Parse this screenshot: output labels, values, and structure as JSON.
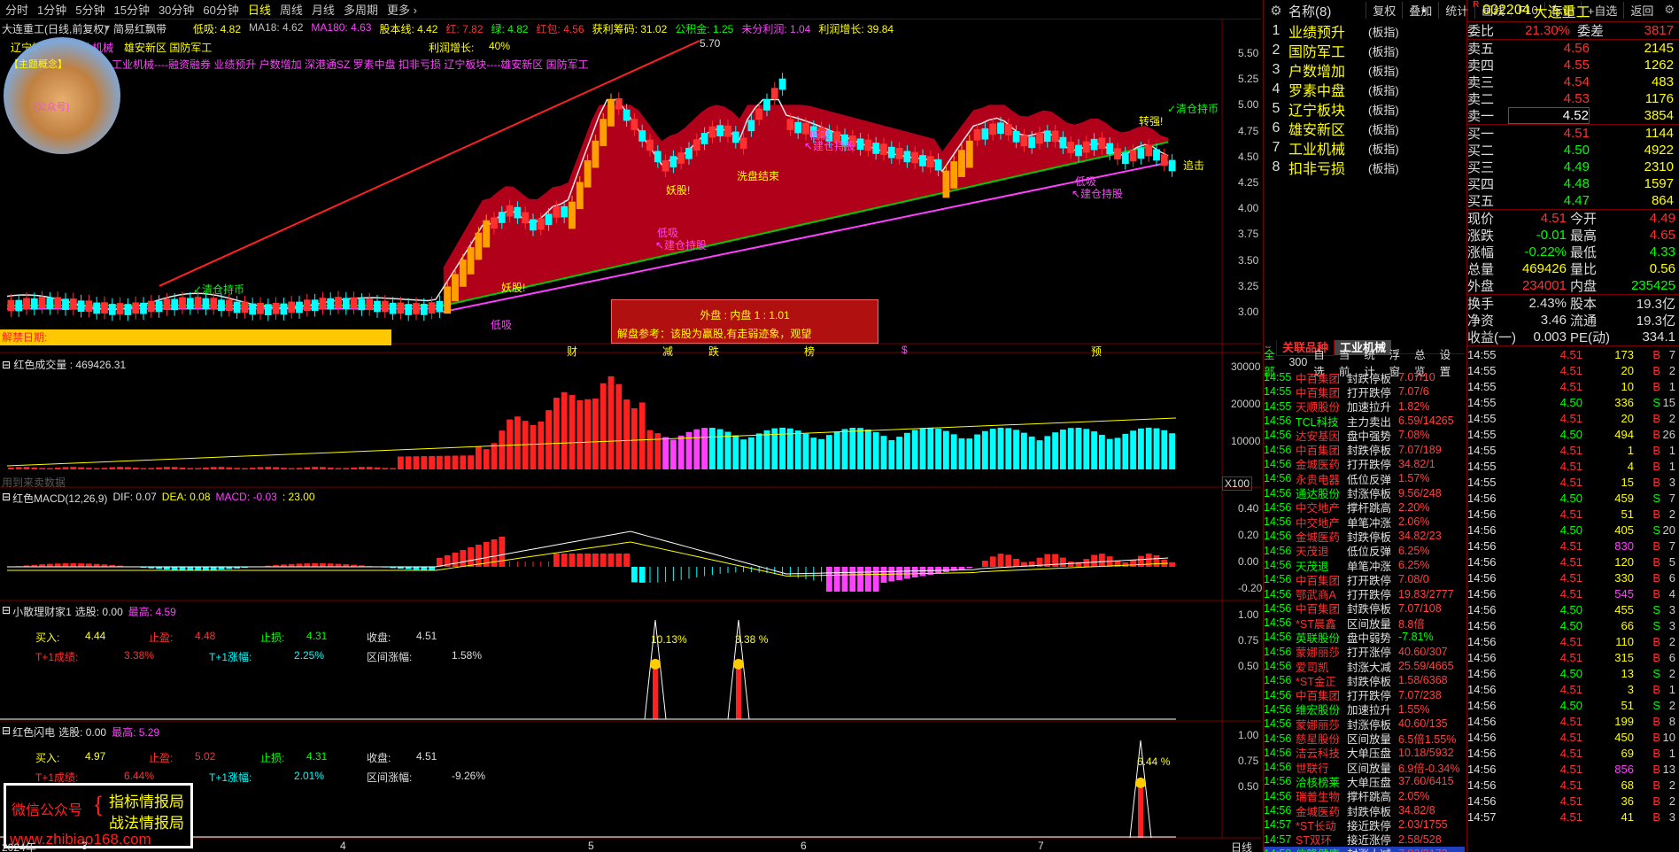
{
  "periods": [
    "分时",
    "1分钟",
    "5分钟",
    "15分钟",
    "30分钟",
    "60分钟",
    "日线",
    "周线",
    "月线",
    "多周期",
    "更多 ›"
  ],
  "toolbar": [
    "复权",
    "叠加",
    "统计",
    "画线",
    "F10",
    "标记",
    "+自选",
    "返回"
  ],
  "main": {
    "title": "大连重工(日线,前复权)",
    "indicator": "简易红飘带",
    "ma": [
      {
        "t": "低吸: 4.82",
        "c": "#ffff00"
      },
      {
        "t": "MA18: 4.62",
        "c": "#c0c0c0"
      },
      {
        "t": "MA180: 4.63",
        "c": "#ff40ff"
      },
      {
        "t": "股本线: 4.42",
        "c": "#ffff00"
      },
      {
        "t": "红: 7.82",
        "c": "#ff3030"
      },
      {
        "t": "绿: 4.82",
        "c": "#00ff00"
      },
      {
        "t": "红包: 4.56",
        "c": "#ff3030"
      },
      {
        "t": "获利筹码: 31.02",
        "c": "#ffff00"
      },
      {
        "t": "公积金: 1.25",
        "c": "#00ff00"
      },
      {
        "t": "未分利润: 1.04",
        "c": "#ff40ff"
      },
      {
        "t": "利润增长: 39.84",
        "c": "#ffff00"
      }
    ],
    "sectors_line1": "辽宁板块",
    "sectors_line1b": "工业机械",
    "sectors_line1c": "雄安新区 国防军工",
    "profit_growth": "利润增长:",
    "profit_growth_val": "40%",
    "concepts": "工业机械----融资融券 业绩预升 户数增加 深港通SZ 罗素中盘 扣非亏损 辽宁板块----雄安新区 国防军工",
    "logo_top": "【主题概念】",
    "logo_mid": "(公众号)",
    "unlock": "解禁日期:",
    "price_high_label": "5.70",
    "yaxis": [
      "5.50",
      "5.25",
      "5.00",
      "4.75",
      "4.50",
      "4.25",
      "4.00",
      "3.75",
      "3.50",
      "3.25",
      "3.00"
    ],
    "annotations": {
      "qingcang1": "✓清仓持币",
      "qingcang2": "✓清仓持币",
      "yaogu1": "妖股!",
      "yaogu2": "妖股!",
      "dixi1": "低吸",
      "dixi2": "低吸",
      "dixi3": "低吸",
      "jiancang1": "↖建仓持股",
      "jiancang2": "↖建仓持股",
      "jiancang3": "↖建仓持股",
      "huadixi": "低吸",
      "huapan": "洗盘结束",
      "zhuanqiang": "转强!",
      "zhuiji": "追击"
    },
    "popup_line1": "外盘 : 内盘  1 : 1.01",
    "popup_line2": "解盘参考：该股为赢股,有走弱迹象，观望",
    "markers": [
      "财",
      "减",
      "跌",
      "榜",
      "$",
      "预"
    ]
  },
  "vol": {
    "title": "红色成交量 : 469426.31",
    "yaxis": [
      "30000",
      "20000",
      "10000"
    ],
    "unit": "X100",
    "watermark": "用到来卖数据"
  },
  "macd": {
    "title": "红色MACD(12,26,9)",
    "dif": "DIF: 0.07",
    "dea": "DEA: 0.08",
    "macd": "MACD: -0.03",
    "extra": ": 23.00",
    "yaxis": [
      "0.40",
      "0.20",
      "0.00",
      "-0.20"
    ]
  },
  "ind1": {
    "title": "小散理财家1",
    "select": "选股: 0.00",
    "high": "最高: 4.59",
    "buy_l": "买入:",
    "buy_v": "4.44",
    "tp_l": "止盈:",
    "tp_v": "4.48",
    "sl_l": "止损:",
    "sl_v": "4.31",
    "close_l": "收盘:",
    "close_v": "4.51",
    "t1_l": "T+1成绩:",
    "t1_v": "3.38%",
    "t1z_l": "T+1涨幅:",
    "t1z_v": "2.25%",
    "rng_l": "区间涨幅:",
    "rng_v": "1.58%",
    "pk1": "10.13%",
    "pk2": "3.38 %",
    "yaxis": [
      "1.00",
      "0.75",
      "0.50"
    ]
  },
  "ind2": {
    "title": "红色闪电",
    "select": "选股: 0.00",
    "high": "最高: 5.29",
    "buy_l": "买入:",
    "buy_v": "4.97",
    "tp_l": "止盈:",
    "tp_v": "5.02",
    "sl_l": "止损:",
    "sl_v": "4.31",
    "close_l": "收盘:",
    "close_v": "4.51",
    "t1_l": "T+1成绩:",
    "t1_v": "6.44%",
    "t1z_l": "T+1涨幅:",
    "t1z_v": "2.01%",
    "rng_l": "区间涨幅:",
    "rng_v": "-9.26%",
    "pk1": "6.44 %",
    "yaxis": [
      "1.00",
      "0.75",
      "0.50"
    ]
  },
  "xaxis": [
    "2024年",
    "3",
    "4",
    "5",
    "6",
    "7"
  ],
  "xaxis_right": "日线",
  "ad": {
    "l1": "微信公众号",
    "b1": "指标情报局",
    "b2": "战法情报局",
    "url": "www.zhibiao168.com"
  },
  "sectors": {
    "header": "名称(8)",
    "items": [
      {
        "n": "1",
        "name": "业绩预升",
        "tag": "(板指)"
      },
      {
        "n": "2",
        "name": "国防军工",
        "tag": "(板指)"
      },
      {
        "n": "3",
        "name": "户数增加",
        "tag": "(板指)"
      },
      {
        "n": "4",
        "name": "罗素中盘",
        "tag": "(板指)"
      },
      {
        "n": "5",
        "name": "辽宁板块",
        "tag": "(板指)"
      },
      {
        "n": "6",
        "name": "雄安新区",
        "tag": "(板指)"
      },
      {
        "n": "7",
        "name": "工业机械",
        "tag": "(板指)"
      },
      {
        "n": "8",
        "name": "扣非亏损",
        "tag": "(板指)"
      }
    ]
  },
  "feed": {
    "tab1": "关联品种",
    "tab2": "工业机械",
    "subtabs": [
      "全部",
      "300",
      "自选",
      "当前",
      "统计",
      "浮窗",
      "总览",
      "设置"
    ],
    "rows": [
      {
        "t": "14:55",
        "s": "中百集团",
        "e": "封跌停板",
        "v": "7.07/10"
      },
      {
        "t": "14:55",
        "s": "中百集团",
        "e": "打开跌停",
        "v": "7.07/6"
      },
      {
        "t": "14:55",
        "s": "天顺股份",
        "e": "加速拉升",
        "v": "1.82%"
      },
      {
        "t": "14:56",
        "s": "TCL科技",
        "e": "主力卖出",
        "v": "6.59/14265"
      },
      {
        "t": "14:56",
        "s": "达安基因",
        "e": "盘中强势",
        "v": "7.08%"
      },
      {
        "t": "14:56",
        "s": "中百集团",
        "e": "封跌停板",
        "v": "7.07/189"
      },
      {
        "t": "14:56",
        "s": "金城医药",
        "e": "打开跌停",
        "v": "34.82/1"
      },
      {
        "t": "14:56",
        "s": "永贵电器",
        "e": "低位反弹",
        "v": "1.57%"
      },
      {
        "t": "14:56",
        "s": "通达股份",
        "e": "封涨停板",
        "v": "9.56/248"
      },
      {
        "t": "14:56",
        "s": "中交地产",
        "e": "撑杆跳高",
        "v": "2.20%"
      },
      {
        "t": "14:56",
        "s": "中交地产",
        "e": "单笔冲涨",
        "v": "2.06%"
      },
      {
        "t": "14:56",
        "s": "金城医药",
        "e": "封跌停板",
        "v": "34.82/23"
      },
      {
        "t": "14:56",
        "s": "天茂退",
        "e": "低位反弹",
        "v": "6.25%"
      },
      {
        "t": "14:56",
        "s": "天茂退",
        "e": "单笔冲涨",
        "v": "6.25%"
      },
      {
        "t": "14:56",
        "s": "中百集团",
        "e": "打开跌停",
        "v": "7.08/0"
      },
      {
        "t": "14:56",
        "s": "鄂武商A",
        "e": "打开跌停",
        "v": "19.83/2777"
      },
      {
        "t": "14:56",
        "s": "中百集团",
        "e": "封跌停板",
        "v": "7.07/108"
      },
      {
        "t": "14:56",
        "s": "*ST晨鑫",
        "e": "区间放量",
        "v": "8.8倍"
      },
      {
        "t": "14:56",
        "s": "英联股份",
        "e": "盘中弱势",
        "v": "-7.81%"
      },
      {
        "t": "14:56",
        "s": "蒙娜丽莎",
        "e": "打开涨停",
        "v": "40.60/307"
      },
      {
        "t": "14:56",
        "s": "爱司凯",
        "e": "封涨大减",
        "v": "25.59/4665"
      },
      {
        "t": "14:56",
        "s": "*ST金正",
        "e": "封跌停板",
        "v": "1.58/6368"
      },
      {
        "t": "14:56",
        "s": "中百集团",
        "e": "打开跌停",
        "v": "7.07/238"
      },
      {
        "t": "14:56",
        "s": "维宏股份",
        "e": "加速拉升",
        "v": "1.55%"
      },
      {
        "t": "14:56",
        "s": "蒙娜丽莎",
        "e": "封涨停板",
        "v": "40.60/135"
      },
      {
        "t": "14:56",
        "s": "慈星股份",
        "e": "区间放量",
        "v": "6.5倍1.55%"
      },
      {
        "t": "14:56",
        "s": "洁云科技",
        "e": "大单压盘",
        "v": "10.18/5932"
      },
      {
        "t": "14:56",
        "s": "世联行",
        "e": "区间放量",
        "v": "6.9倍-0.34%"
      },
      {
        "t": "14:56",
        "s": "洽核榜莱",
        "e": "大单压盘",
        "v": "37.60/6415"
      },
      {
        "t": "14:56",
        "s": "瑞普生物",
        "e": "撑杆跳高",
        "v": "2.05%"
      },
      {
        "t": "14:56",
        "s": "金城医药",
        "e": "封跌停板",
        "v": "34.82/8"
      },
      {
        "t": "14:57",
        "s": "*ST长动",
        "e": "接近跌停",
        "v": "2.03/1755"
      },
      {
        "t": "14:57",
        "s": "ST双环",
        "e": "接近涨停",
        "v": "2.58/528"
      },
      {
        "t": "14:58",
        "s": "信隆健康",
        "e": "封涨大减",
        "v": "7.93/3173"
      }
    ]
  },
  "quote": {
    "code": "002204",
    "name": "大连重工",
    "r": "R",
    "wb_l": "委比",
    "wb_v": "21.30%",
    "wc_l": "委差",
    "wc_v": "3817",
    "asks": [
      {
        "k": "卖五",
        "p": "4.56",
        "v": "2145"
      },
      {
        "k": "卖四",
        "p": "4.55",
        "v": "1262"
      },
      {
        "k": "卖三",
        "p": "4.54",
        "v": "483"
      },
      {
        "k": "卖二",
        "p": "4.53",
        "v": "1176"
      },
      {
        "k": "卖一",
        "p": "4.52",
        "v": "3854"
      }
    ],
    "bids": [
      {
        "k": "买一",
        "p": "4.51",
        "v": "1144"
      },
      {
        "k": "买二",
        "p": "4.50",
        "v": "4922"
      },
      {
        "k": "买三",
        "p": "4.49",
        "v": "2310"
      },
      {
        "k": "买四",
        "p": "4.48",
        "v": "1597"
      },
      {
        "k": "买五",
        "p": "4.47",
        "v": "864"
      }
    ],
    "stats": [
      {
        "a": "现价",
        "av": "4.51",
        "ac": "#ff3030",
        "b": "今开",
        "bv": "4.49",
        "bc": "#ff3030"
      },
      {
        "a": "涨跌",
        "av": "-0.01",
        "ac": "#00ff00",
        "b": "最高",
        "bv": "4.65",
        "bc": "#ff3030"
      },
      {
        "a": "涨幅",
        "av": "-0.22%",
        "ac": "#00ff00",
        "b": "最低",
        "bv": "4.33",
        "bc": "#00ff00"
      },
      {
        "a": "总量",
        "av": "469426",
        "ac": "#ffff00",
        "b": "量比",
        "bv": "0.56",
        "bc": "#ffff00"
      },
      {
        "a": "外盘",
        "av": "234001",
        "ac": "#ff3030",
        "b": "内盘",
        "bv": "235425",
        "bc": "#00ff00"
      }
    ],
    "stats2": [
      {
        "a": "换手",
        "av": "2.43%",
        "b": "股本",
        "bv": "19.3亿"
      },
      {
        "a": "净资",
        "av": "3.46",
        "b": "流通",
        "bv": "19.3亿"
      },
      {
        "a": "收益(一)",
        "av": "0.003",
        "b": "PE(动)",
        "bv": "334.1"
      }
    ],
    "ticks": [
      {
        "t": "14:55",
        "p": "4.51",
        "v": "173",
        "d": "B",
        "c": "7"
      },
      {
        "t": "14:55",
        "p": "4.51",
        "v": "20",
        "d": "B",
        "c": "2"
      },
      {
        "t": "14:55",
        "p": "4.51",
        "v": "10",
        "d": "B",
        "c": "1"
      },
      {
        "t": "14:55",
        "p": "4.50",
        "v": "336",
        "d": "S",
        "c": "15"
      },
      {
        "t": "14:55",
        "p": "4.51",
        "v": "20",
        "d": "B",
        "c": "2"
      },
      {
        "t": "14:55",
        "p": "4.50",
        "v": "494",
        "d": "B",
        "c": "26"
      },
      {
        "t": "14:55",
        "p": "4.51",
        "v": "1",
        "d": "B",
        "c": "1"
      },
      {
        "t": "14:55",
        "p": "4.51",
        "v": "4",
        "d": "B",
        "c": "1"
      },
      {
        "t": "14:55",
        "p": "4.51",
        "v": "15",
        "d": "B",
        "c": "3"
      },
      {
        "t": "14:56",
        "p": "4.50",
        "v": "459",
        "d": "S",
        "c": "7"
      },
      {
        "t": "14:56",
        "p": "4.51",
        "v": "51",
        "d": "B",
        "c": "2"
      },
      {
        "t": "14:56",
        "p": "4.50",
        "v": "405",
        "d": "S",
        "c": "20"
      },
      {
        "t": "14:56",
        "p": "4.51",
        "v": "830",
        "d": "B",
        "c": "7"
      },
      {
        "t": "14:56",
        "p": "4.51",
        "v": "120",
        "d": "B",
        "c": "5"
      },
      {
        "t": "14:56",
        "p": "4.51",
        "v": "330",
        "d": "B",
        "c": "6"
      },
      {
        "t": "14:56",
        "p": "4.51",
        "v": "545",
        "d": "B",
        "c": "4"
      },
      {
        "t": "14:56",
        "p": "4.50",
        "v": "455",
        "d": "S",
        "c": "3"
      },
      {
        "t": "14:56",
        "p": "4.50",
        "v": "66",
        "d": "S",
        "c": "3"
      },
      {
        "t": "14:56",
        "p": "4.51",
        "v": "110",
        "d": "B",
        "c": "2"
      },
      {
        "t": "14:56",
        "p": "4.51",
        "v": "315",
        "d": "B",
        "c": "6"
      },
      {
        "t": "14:56",
        "p": "4.50",
        "v": "13",
        "d": "S",
        "c": "2"
      },
      {
        "t": "14:56",
        "p": "4.51",
        "v": "3",
        "d": "B",
        "c": "1"
      },
      {
        "t": "14:56",
        "p": "4.50",
        "v": "51",
        "d": "S",
        "c": "2"
      },
      {
        "t": "14:56",
        "p": "4.51",
        "v": "199",
        "d": "B",
        "c": "8"
      },
      {
        "t": "14:56",
        "p": "4.51",
        "v": "450",
        "d": "B",
        "c": "10"
      },
      {
        "t": "14:56",
        "p": "4.51",
        "v": "69",
        "d": "B",
        "c": "1"
      },
      {
        "t": "14:56",
        "p": "4.51",
        "v": "856",
        "d": "B",
        "c": "13"
      },
      {
        "t": "14:56",
        "p": "4.51",
        "v": "68",
        "d": "B",
        "c": "2"
      },
      {
        "t": "14:56",
        "p": "4.51",
        "v": "36",
        "d": "B",
        "c": "2"
      },
      {
        "t": "14:57",
        "p": "4.51",
        "v": "41",
        "d": "B",
        "c": "3"
      }
    ]
  },
  "colors": {
    "up": "#ff3030",
    "down": "#00ffff",
    "ma_green": "#00c800",
    "ribbon": "#b0001a",
    "magenta": "#ff40ff",
    "yellow": "#ffff00",
    "frame": "#7a0000"
  }
}
